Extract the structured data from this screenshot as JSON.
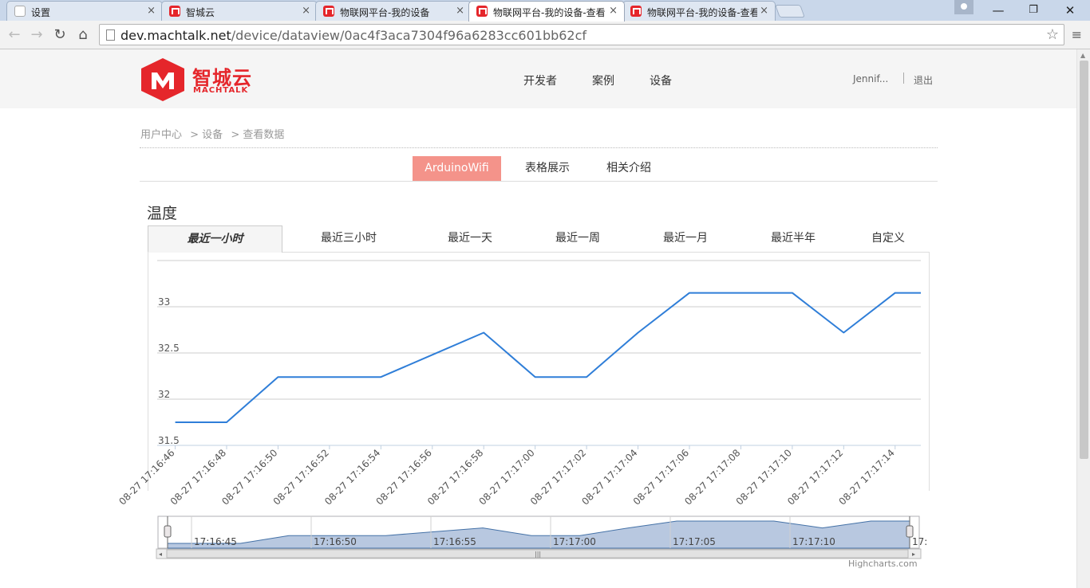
{
  "browser": {
    "tabs": [
      {
        "title": "设置",
        "icon": "doc"
      },
      {
        "title": "智城云",
        "icon": "brand"
      },
      {
        "title": "物联网平台-我的设备",
        "icon": "brand"
      },
      {
        "title": "物联网平台-我的设备-查看",
        "icon": "brand",
        "active": true
      },
      {
        "title": "物联网平台-我的设备-查看",
        "icon": "brand"
      }
    ],
    "close_glyph": "×",
    "url_host": "dev.machtalk.net",
    "url_path": "/device/dataview/0ac4f3aca7304f96a6283cc601bb62cf"
  },
  "site": {
    "logo_cn": "智城云",
    "logo_en": "MACHTALK",
    "nav": [
      "开发者",
      "案例",
      "设备"
    ],
    "user": "Jennif...",
    "logout": "退出"
  },
  "breadcrumb": [
    "用户中心",
    "> 设备",
    "> 查看数据"
  ],
  "subtabs": {
    "device": "ArduinoWifi",
    "table": "表格展示",
    "intro": "相关介绍"
  },
  "section_title": "温度",
  "range_tabs": [
    "最近一小时",
    "最近三小时",
    "最近一天",
    "最近一周",
    "最近一月",
    "最近半年",
    "自定义"
  ],
  "chart_data": {
    "type": "line",
    "title": "",
    "xlabel": "",
    "ylabel": "",
    "ylim": [
      31.5,
      33.5
    ],
    "y_ticks": [
      "31.5",
      "32",
      "32.5",
      "33"
    ],
    "x_ticks": [
      "08-27 17:16:46",
      "08-27 17:16:48",
      "08-27 17:16:50",
      "08-27 17:16:52",
      "08-27 17:16:54",
      "08-27 17:16:56",
      "08-27 17:16:58",
      "08-27 17:17:00",
      "08-27 17:17:02",
      "08-27 17:17:04",
      "08-27 17:17:06",
      "08-27 17:17:08",
      "08-27 17:17:10",
      "08-27 17:17:12",
      "08-27 17:17:14"
    ],
    "series": [
      {
        "color": "#2f7ed8",
        "x": [
          "17:16:46",
          "17:16:48",
          "17:16:50",
          "17:16:52",
          "17:16:54",
          "17:16:56",
          "17:16:58",
          "17:17:00",
          "17:17:02",
          "17:17:04",
          "17:17:06",
          "17:17:08",
          "17:17:10",
          "17:17:12",
          "17:17:14",
          "17:17:15"
        ],
        "values": [
          31.75,
          31.75,
          32.24,
          32.24,
          32.24,
          32.48,
          32.72,
          32.24,
          32.24,
          32.72,
          33.15,
          33.15,
          33.15,
          32.72,
          33.15,
          33.15
        ]
      }
    ],
    "navigator": {
      "labels": [
        "17:16:45",
        "17:16:50",
        "17:16:55",
        "17:17:00",
        "17:17:05",
        "17:17:10",
        "17:"
      ],
      "fill": "#b8c8e0",
      "stroke": "#4572a7"
    },
    "grid": true,
    "credits": "Highcharts.com"
  }
}
